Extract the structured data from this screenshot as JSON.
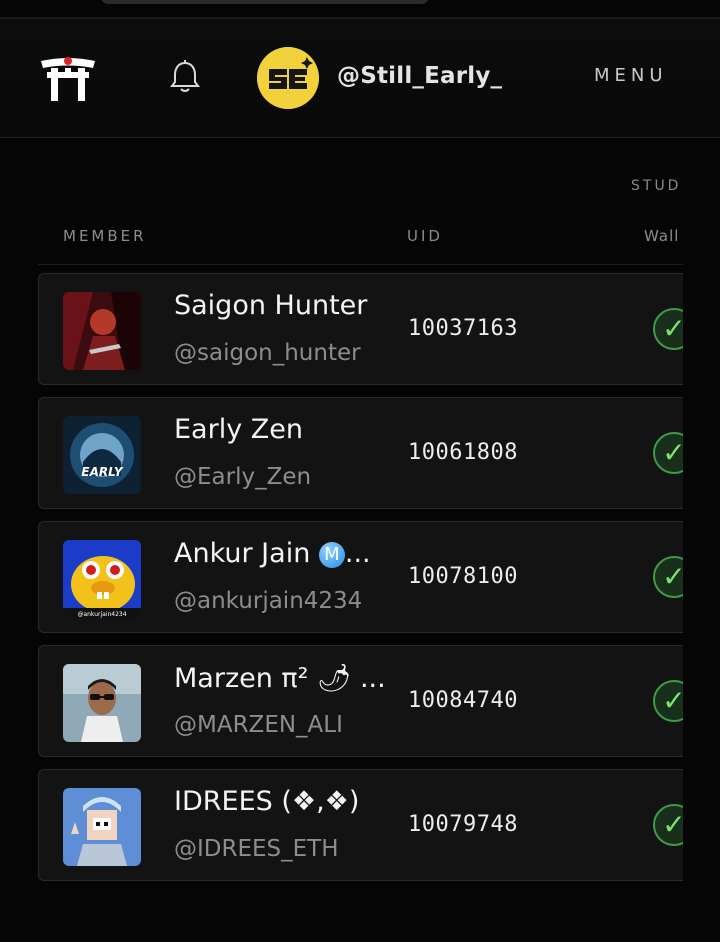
{
  "header": {
    "handle": "@Still_Early_",
    "menu_label": "MENU",
    "logo_icon": "torii-gate-icon",
    "notification_icon": "bell-icon"
  },
  "table": {
    "section_label": "STUD",
    "columns": {
      "member": "MEMBER",
      "uid": "UID",
      "wallet": "Wall"
    },
    "rows": [
      {
        "name": "Saigon Hunter",
        "handle": "@saigon_hunter",
        "uid": "10037163",
        "status": "✓"
      },
      {
        "name": "Early Zen",
        "handle": "@Early_Zen",
        "uid": "10061808",
        "status": "✓",
        "avatar_text": "EARLY"
      },
      {
        "name": "Ankur Jain ",
        "name_badge": "M",
        "name_suffix": "...",
        "handle": "@ankurjain4234",
        "uid": "10078100",
        "status": "✓",
        "avatar_text": "@ankurjain4234"
      },
      {
        "name": "Marzen π² 🌶 ...",
        "handle": "@MARZEN_ALI",
        "uid": "10084740",
        "status": "✓"
      },
      {
        "name": "IDREES (❖,❖)",
        "handle": "@IDREES_ETH",
        "uid": "10079748",
        "status": "✓"
      }
    ]
  },
  "colors": {
    "background": "#050505",
    "row_background": "#131314",
    "verified_green": "#3f9b45",
    "header_avatar": "#f2d23a"
  }
}
